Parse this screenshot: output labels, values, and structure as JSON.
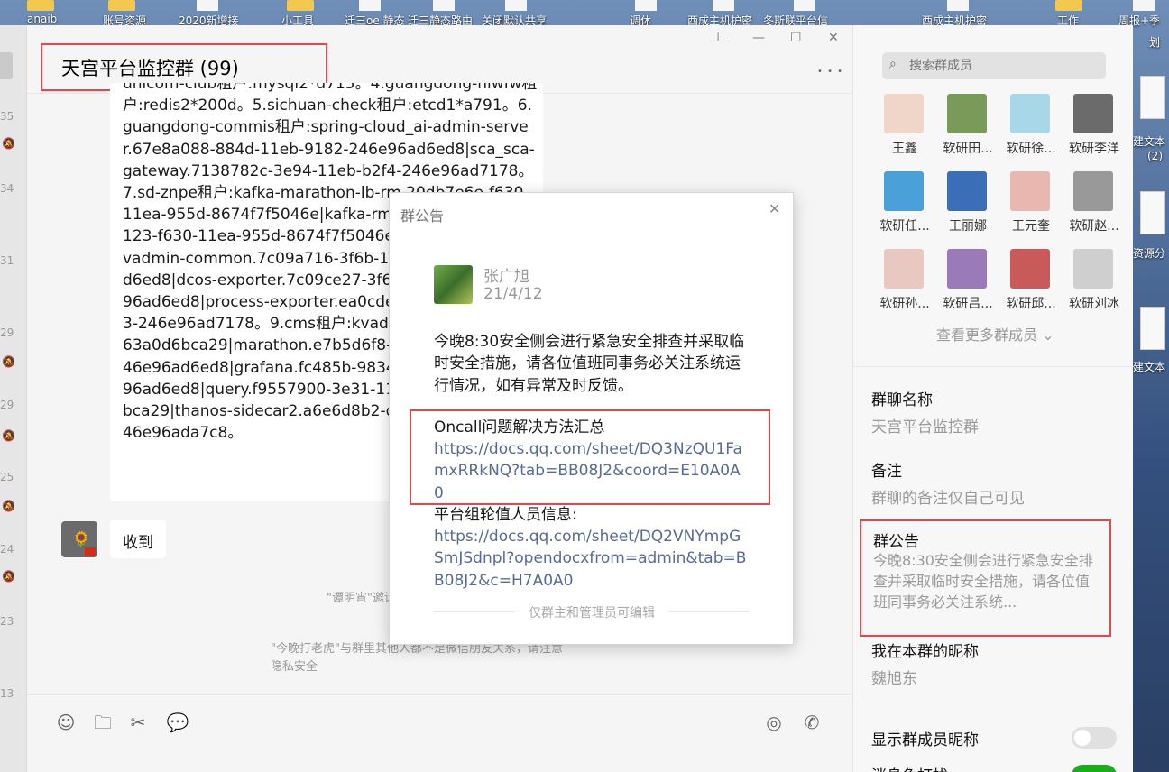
{
  "desktop": {
    "icons": [
      "anaib",
      "账号资源",
      "2020新增接",
      "小工具",
      "迁三oe 静态",
      "迁三静态路由",
      "关闭默认共享",
      "调休",
      "西成主机护密",
      "冬斯联平台信",
      "西成主机护密",
      "工作",
      "周报+季"
    ],
    "right_labels": [
      "划",
      "建文本",
      "(2)",
      "资源分",
      "建文本"
    ]
  },
  "left_strip": {
    "numbers": [
      "35",
      "34",
      "31",
      "29",
      "29",
      "25",
      "24",
      "23",
      "13"
    ]
  },
  "chat": {
    "title": "天宫平台监控群 (99)",
    "message_text": "unicom-club租户:mysql2*d715。4.guangdong-hlwfw租户:redis2*200d。5.sichuan-check租户:etcd1*a791。6.guangdong-commis租户:spring-cloud_ai-admin-server.67e8a088-884d-11eb-9182-246e96ad6ed8|sca_sca-gateway.7138782c-3e94-11eb-b2f4-246e96ad7178。7.sd-znpe租户:kafka-marathon-lb-rm.20db7e6e-f630-11ea-955d-8674f7f5046e|kafka-rm_kafka-rm-7.b3d9a123-f630-11ea-955d-8674f7f5046e。8.monitor租户:kvadmin-common.7c09a716-3f6b-11eb-b6b3-246e96ad6ed8|dcos-exporter.7c09ce27-3f6b-11eb-b6b3-246e96ad6ed8|process-exporter.ea0cdeee-3f6b-11eb-b6b3-246e96ad7178。9.cms租户:kvadmin-1-11eb-8601-963a0d6bca29|marathon.e7b5d6f8-d59d-11ea-93a7-246e96ad6ed8|grafana.fc485b-9834-11eb-9146-246e96ad6ed8|query.f9557900-3e31-11eb-8601-963a0d6bca29|thanos-sidecar2.a6e6d8b2-d539-11ea-93a7-246e96ada7c8。",
    "reply_text": "收到",
    "system_msg_1": "\"谭明宵\"邀请\"今晚打老虎\"加入了群聊",
    "system_msg_2_line1": "\"今晚打老虎\"与群里其他人都不是微信朋友关系，请注意",
    "system_msg_2_line2": "隐私安全",
    "window_controls": [
      "⊥",
      "—",
      "☐",
      "✕"
    ],
    "more": "• • •"
  },
  "input_tools": [
    "emoji-icon",
    "folder-icon",
    "scissors-icon",
    "chat-bubble-icon",
    "live-icon",
    "voice-call-icon"
  ],
  "panel": {
    "search_placeholder": "搜索群成员",
    "members": [
      {
        "name": "王鑫",
        "color": "#f0d6c8"
      },
      {
        "name": "软研田...",
        "color": "#7a9a5a"
      },
      {
        "name": "软研徐...",
        "color": "#a8d8e8"
      },
      {
        "name": "软研李洋",
        "color": "#6b6b6b"
      },
      {
        "name": "软研任...",
        "color": "#4aa0d8"
      },
      {
        "name": "王丽娜",
        "color": "#3a6fb8"
      },
      {
        "name": "王元奎",
        "color": "#e8b8b0"
      },
      {
        "name": "软研赵...",
        "color": "#999999"
      },
      {
        "name": "软研孙...",
        "color": "#e8c8c0"
      },
      {
        "name": "软研吕...",
        "color": "#9a7ab8"
      },
      {
        "name": "软研邱...",
        "color": "#c85a5a"
      },
      {
        "name": "软研刘冰",
        "color": "#cfcfcf"
      }
    ],
    "see_more": "查看更多群成员 ⌄",
    "group_name_label": "群聊名称",
    "group_name_value": "天宫平台监控群",
    "remark_label": "备注",
    "remark_value": "群聊的备注仅自己可见",
    "notice_label": "群公告",
    "notice_value": "今晚8:30安全侧会进行紧急安全排查并采取临时安全措施，请各位值班同事务必关注系统...",
    "nickname_label": "我在本群的昵称",
    "nickname_value": "魏旭东",
    "show_nickname_label": "显示群成员昵称",
    "show_nickname_on": false,
    "last_label_partial": "消息免打扰"
  },
  "popup": {
    "title": "群公告",
    "close": "✕",
    "author": "张广旭",
    "date": "21/4/12",
    "body": "今晚8:30安全侧会进行紧急安全排查并采取临时安全措施，请各位值班同事务必关注系统运行情况，如有异常及时反馈。",
    "oncall_label": "Oncall问题解决方法汇总",
    "oncall_link": "https://docs.qq.com/sheet/DQ3NzQU1FamxRRkNQ?tab=BB08J2&coord=E10A0A0",
    "roster_label": "平台组轮值人员信息:",
    "roster_link": "https://docs.qq.com/sheet/DQ2VNYmpGSmJSdnpl?opendocxfrom=admin&tab=BB08J2&c=H7A0A0",
    "footer": "仅群主和管理员可编辑"
  },
  "colors": {
    "highlight_red": "#e8464a",
    "link_blue": "#576b95",
    "toggle_on": "#1aad19"
  }
}
